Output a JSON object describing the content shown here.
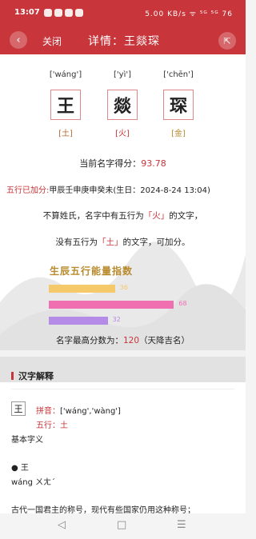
{
  "status": {
    "time": "13:07",
    "right": "5.00 KB/s ᯤ ⁵ᴳ ⁵ᴳ 76"
  },
  "nav": {
    "back_icon": "‹",
    "close": "关闭",
    "title": "详情：王燚琛",
    "share_icon": "⇱"
  },
  "chars": [
    {
      "pinyin": "['wáng']",
      "char": "王",
      "element": "[土]",
      "color": "#b56a32"
    },
    {
      "pinyin": "['yì']",
      "char": "燚",
      "element": "[火]",
      "color": "#c8353a"
    },
    {
      "pinyin": "['chēn']",
      "char": "琛",
      "element": "[金]",
      "color": "#b88a2c"
    }
  ],
  "score": {
    "label": "当前名字得分：",
    "value": "93.78"
  },
  "bonus": {
    "label": "五行已加分:",
    "text": "甲辰壬申庚申癸未(生日：2024-8-24 13:04)"
  },
  "hint1": {
    "pre": "不算姓氏，名字中有五行为",
    "hl": "「火」",
    "post": "的文字，"
  },
  "hint2": {
    "pre": "没有五行为",
    "hl": "「土」",
    "post": "的文字，可加分。"
  },
  "energy": {
    "title": "生辰五行能量指数",
    "bars": [
      {
        "value": 36,
        "color": "#f5c96a"
      },
      {
        "value": 68,
        "color": "#f06fb1"
      },
      {
        "value": 32,
        "color": "#b48be6"
      }
    ]
  },
  "maxscore": {
    "pre": "名字最高分数为：",
    "value": "120",
    "post": "（天降吉名）"
  },
  "section": {
    "title": "汉字解释"
  },
  "detail": {
    "char": "王",
    "pinyin_label": "拼音：",
    "pinyin": "['wáng','wàng']",
    "wuxing_label": "五行：",
    "wuxing": "土",
    "basic": "基本字义",
    "bullet": "● 王",
    "phonetic": "wáng ㄨㄤˊ",
    "cut": "古代一国君主的称号，现代有些国家仍用这种称号；"
  },
  "sysnav": {
    "back": "◁",
    "home": "□",
    "menu": "☰"
  }
}
